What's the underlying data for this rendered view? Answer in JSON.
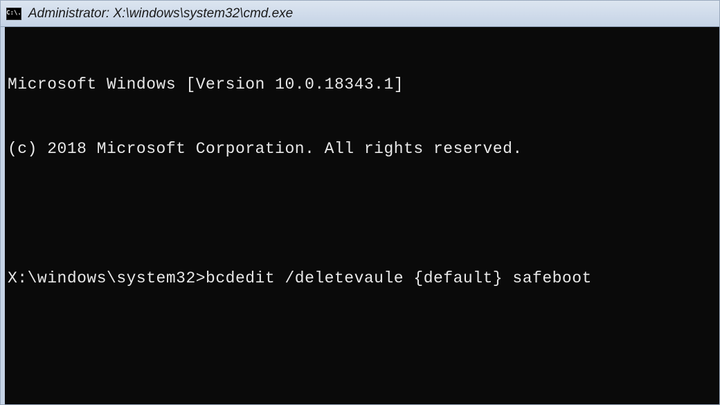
{
  "window": {
    "icon_label": "C:\\.",
    "title": "Administrator: X:\\windows\\system32\\cmd.exe"
  },
  "terminal": {
    "line1": "Microsoft Windows [Version 10.0.18343.1]",
    "line2": "(c) 2018 Microsoft Corporation. All rights reserved.",
    "prompt": "X:\\windows\\system32>",
    "command": "bcdedit /deletevaule {default} safeboot"
  }
}
